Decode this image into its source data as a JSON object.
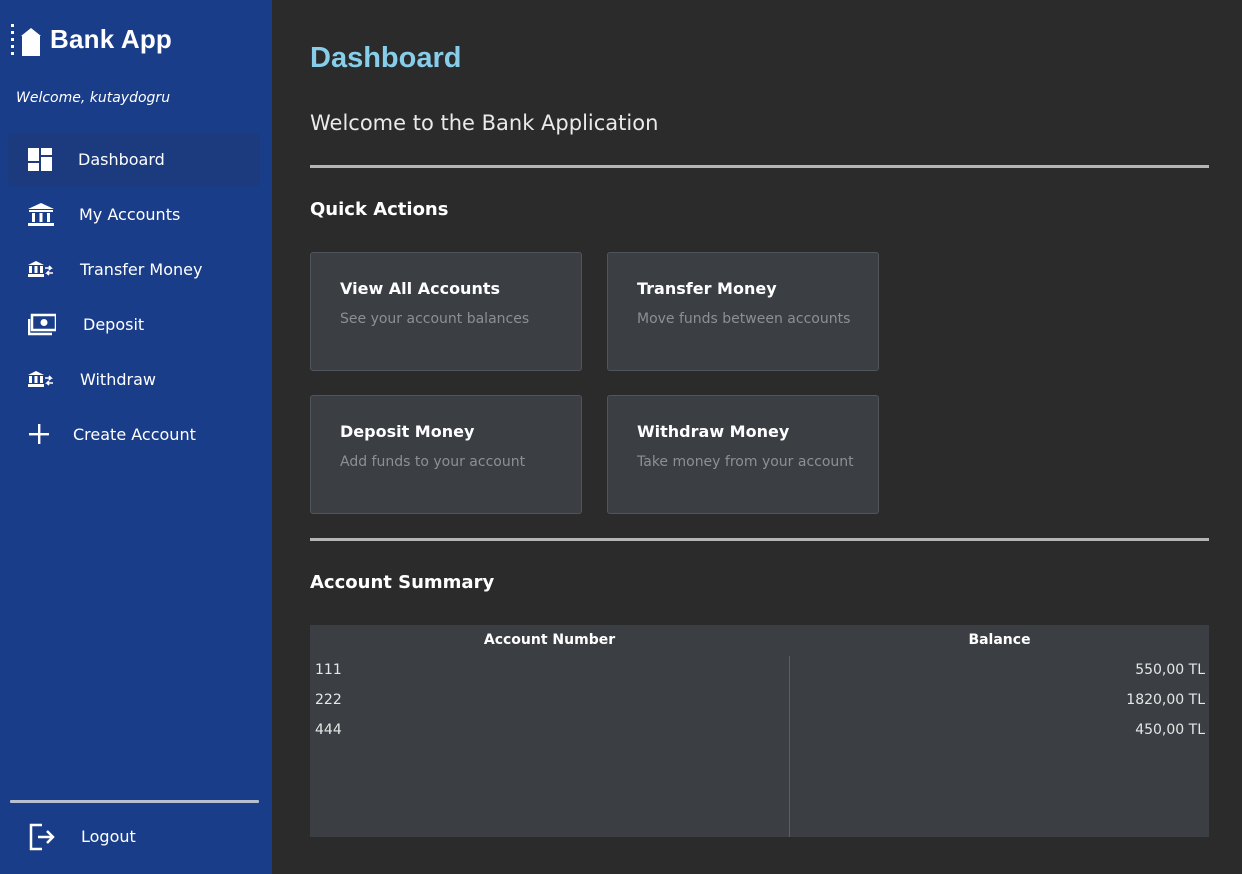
{
  "sidebar": {
    "app_title": "Bank App",
    "welcome": "Welcome, kutaydogru",
    "items": [
      {
        "label": "Dashboard",
        "icon": "dashboard-icon",
        "active": true
      },
      {
        "label": "My Accounts",
        "icon": "bank-icon"
      },
      {
        "label": "Transfer Money",
        "icon": "transfer-icon"
      },
      {
        "label": "Deposit",
        "icon": "money-icon"
      },
      {
        "label": "Withdraw",
        "icon": "withdraw-icon"
      },
      {
        "label": "Create Account",
        "icon": "plus-icon"
      }
    ],
    "logout_label": "Logout"
  },
  "main": {
    "title": "Dashboard",
    "subtitle": "Welcome to the Bank Application",
    "quick_actions_title": "Quick Actions",
    "cards": [
      {
        "title": "View All Accounts",
        "desc": "See your account balances"
      },
      {
        "title": "Transfer Money",
        "desc": "Move funds between accounts"
      },
      {
        "title": "Deposit Money",
        "desc": "Add funds to your account"
      },
      {
        "title": "Withdraw Money",
        "desc": "Take money from your account"
      }
    ],
    "summary_title": "Account Summary",
    "table": {
      "headers": [
        "Account Number",
        "Balance"
      ],
      "rows": [
        {
          "account": "111",
          "balance": "550,00 TL"
        },
        {
          "account": "222",
          "balance": "1820,00 TL"
        },
        {
          "account": "444",
          "balance": "450,00 TL"
        }
      ]
    }
  },
  "colors": {
    "sidebar_bg": "#1a3d8a",
    "main_bg": "#2b2b2b",
    "title_accent": "#87ceeb",
    "card_bg": "#3b3f43"
  }
}
